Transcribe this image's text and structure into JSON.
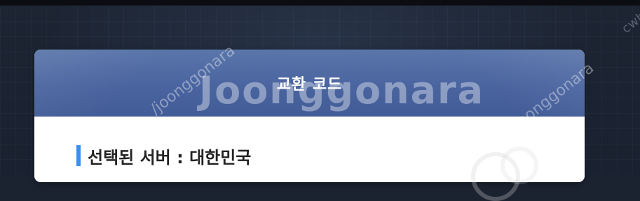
{
  "dialog": {
    "title": "교환 코드",
    "server_label": "선택된 서버 : 대한민국"
  },
  "watermark": {
    "logo_text": "Joonggonara",
    "diagonal_text": "/joonggonara",
    "corner_text": "cwhc"
  },
  "colors": {
    "header": "#4a64a0",
    "accent_bar": "#3a8ff0",
    "background": "#1b2230"
  }
}
